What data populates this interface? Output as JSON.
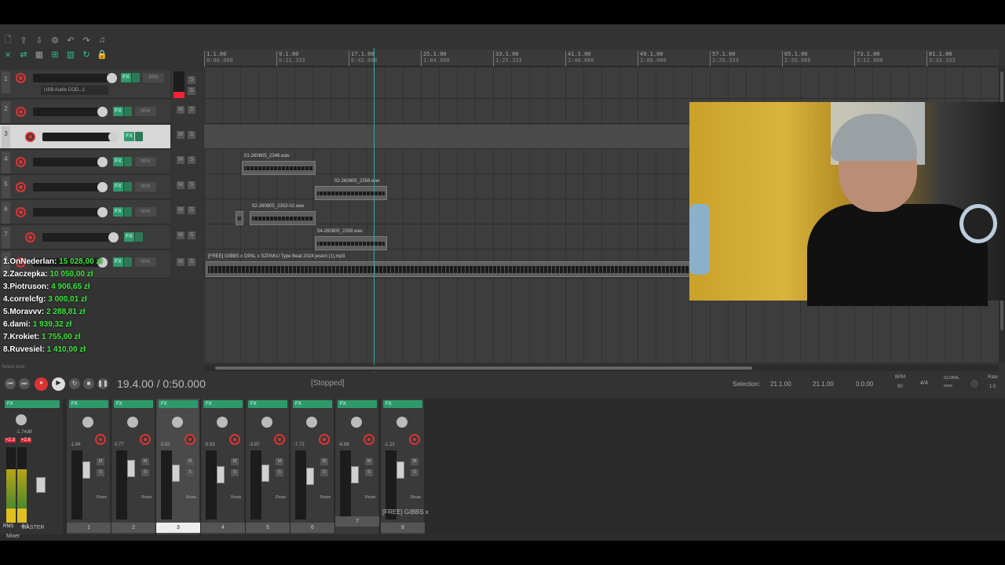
{
  "toolbar": {
    "row1": [
      "new-project-icon",
      "open-project-icon",
      "save-project-icon",
      "project-settings-icon",
      "undo-icon",
      "redo-icon",
      "metronome-icon"
    ],
    "row1_glyphs": [
      "🗋",
      "⇪",
      "⇩",
      "⚙",
      "↶",
      "↷",
      "♫"
    ],
    "row2": [
      "ripple-icon",
      "link-icon",
      "grid-icon",
      "snap-icon",
      "grid-lines-icon",
      "loop-icon",
      "lock-icon"
    ],
    "row2_glyphs": [
      "⨯",
      "⇄",
      "▦",
      "⊞",
      "▥",
      "↻",
      "🔒"
    ]
  },
  "ruler": [
    {
      "bar": "1.1.00",
      "time": "0:00.000"
    },
    {
      "bar": "9.1.00",
      "time": "0:21.333"
    },
    {
      "bar": "17.1.00",
      "time": "0:42.666"
    },
    {
      "bar": "25.1.00",
      "time": "1:04.000"
    },
    {
      "bar": "33.1.00",
      "time": "1:25.333"
    },
    {
      "bar": "41.1.00",
      "time": "1:46.666"
    },
    {
      "bar": "49.1.00",
      "time": "2:08.000"
    },
    {
      "bar": "57.1.00",
      "time": "2:29.333"
    },
    {
      "bar": "65.1.00",
      "time": "2:50.666"
    },
    {
      "bar": "73.1.00",
      "time": "3:12.000"
    },
    {
      "bar": "81.1.00",
      "time": "3:33.333"
    }
  ],
  "tracks": [
    {
      "num": "1",
      "input": "USB Audio COD...1",
      "fx": "FX",
      "trim": "trim"
    },
    {
      "num": "2",
      "fx": "FX",
      "trim": "trim"
    },
    {
      "num": "3",
      "fx": "FX"
    },
    {
      "num": "4",
      "fx": "FX",
      "trim": "trim"
    },
    {
      "num": "5",
      "fx": "FX",
      "trim": "trim"
    },
    {
      "num": "6",
      "fx": "FX",
      "trim": "trim"
    },
    {
      "num": "7",
      "fx": "FX"
    },
    {
      "num": "8",
      "fx": "FX",
      "trim": "trim"
    }
  ],
  "ms": {
    "mute": "M",
    "solo": "S"
  },
  "leaderboard": [
    {
      "rank": "1.",
      "name": "OnNederlan:",
      "amount": "15 028,00 zł"
    },
    {
      "rank": "2.",
      "name": "Zaczepka:",
      "amount": "10 050,00 zł"
    },
    {
      "rank": "3.",
      "name": "Piotruson:",
      "amount": "4 906,65 zł"
    },
    {
      "rank": "4.",
      "name": "correlcfg:",
      "amount": "3 000,01 zł"
    },
    {
      "rank": "5.",
      "name": "Moravvv:",
      "amount": "2 288,81 zł"
    },
    {
      "rank": "6.",
      "name": "dami:",
      "amount": "1 939,32 zł"
    },
    {
      "rank": "7.",
      "name": "Krokiet:",
      "amount": "1 755,00 zł"
    },
    {
      "rank": "8.",
      "name": "Ruvesiel:",
      "amount": "1 410,00 zł"
    }
  ],
  "items": [
    {
      "name": "01-260805_2346.wav"
    },
    {
      "name": "02-260805_2356.wav"
    },
    {
      "name": "02-260805_2353-02.wav"
    },
    {
      "name": "04-260805_2359.wav"
    },
    {
      "name": "[FREE] GIBBS x OPAL x SZPAKU Type Beat 2024 jesień (1).mp3"
    }
  ],
  "transport": {
    "time": "19.4.00 / 0:50.000",
    "status": "[Stopped]",
    "selection_label": "Selection:",
    "sel_start": "21.1.00",
    "sel_end": "21.1.00",
    "sel_len": "0.0.00",
    "bpm_label": "BPM",
    "bpm": "90",
    "sig": "4/4",
    "global_label": "GLOBAL",
    "global_value": "none",
    "rate_label": "Rate",
    "rate": "1.0",
    "select_time": "Select time"
  },
  "mixer": {
    "master_label": "MASTER",
    "master_db": "-1.74dB",
    "master_peak_l": "+2.3",
    "master_peak_r": "+2.6",
    "rms": "RMS",
    "rms_val": "-6.3",
    "mixer_tab": "Mixer",
    "strips": [
      {
        "num": "1",
        "db": "-1.84"
      },
      {
        "num": "2",
        "db": "0.77"
      },
      {
        "num": "3",
        "db": "-3.82"
      },
      {
        "num": "4",
        "db": "-5.63"
      },
      {
        "num": "5",
        "db": "-3.87"
      },
      {
        "num": "6",
        "db": "-7.72"
      },
      {
        "num": "7",
        "db": "-6.88"
      },
      {
        "num": "8",
        "db": "-1.22"
      }
    ],
    "track8_name": "[FREE] GIBBS x",
    "route": "Route"
  },
  "colors": {
    "accent": "#2e9a6c",
    "record": "#dd3333",
    "amount": "#3de63d"
  }
}
